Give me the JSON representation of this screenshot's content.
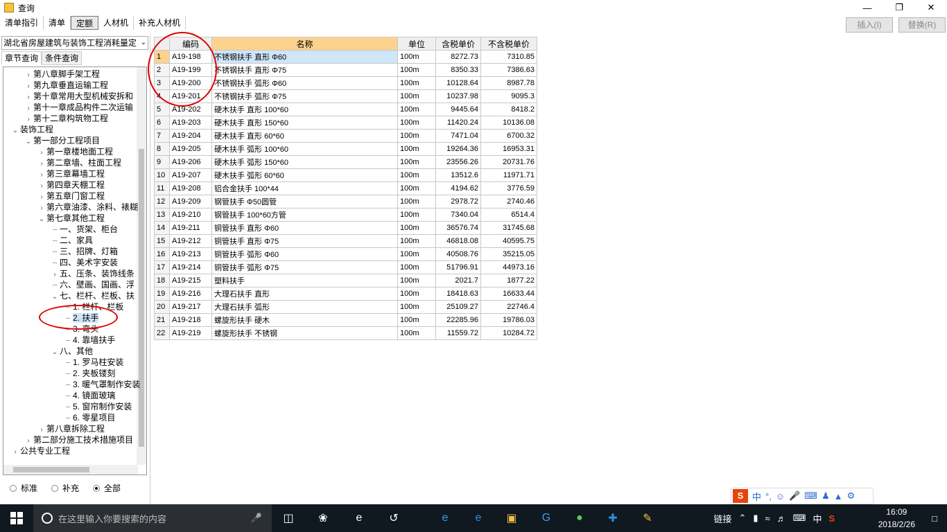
{
  "window": {
    "title": "查询"
  },
  "tabs": [
    "清单指引",
    "清单",
    "定额",
    "人材机",
    "补充人材机"
  ],
  "buttons": {
    "insert": "插入(I)",
    "replace": "替换(R)"
  },
  "left": {
    "quota_select": "湖北省房屋建筑与装饰工程消耗量定",
    "subtabs": [
      "章节查询",
      "条件查询"
    ],
    "tree": [
      {
        "label": "第八章脚手架工程",
        "icon": "chevron-right"
      },
      {
        "label": "第九章垂直运输工程",
        "icon": "chevron-right"
      },
      {
        "label": "第十章常用大型机械安拆和",
        "icon": "chevron-right"
      },
      {
        "label": "第十一章成品构件二次运输",
        "icon": "chevron-right"
      },
      {
        "label": "第十二章构筑物工程",
        "icon": "chevron-right"
      },
      {
        "label": "装饰工程",
        "icon": "chevron-down"
      },
      {
        "label": "第一部分工程项目",
        "icon": "chevron-down"
      },
      {
        "label": "第一章楼地面工程",
        "icon": "chevron-right"
      },
      {
        "label": "第二章墙、柱面工程",
        "icon": "chevron-right"
      },
      {
        "label": "第三章幕墙工程",
        "icon": "chevron-right"
      },
      {
        "label": "第四章天棚工程",
        "icon": "chevron-right"
      },
      {
        "label": "第五章门窗工程",
        "icon": "chevron-right"
      },
      {
        "label": "第六章油漆、涂料、裱糊",
        "icon": "chevron-right"
      },
      {
        "label": "第七章其他工程",
        "icon": "chevron-down"
      },
      {
        "label": "一、货架、柜台",
        "icon": ""
      },
      {
        "label": "二、家具",
        "icon": ""
      },
      {
        "label": "三、招牌、灯箱",
        "icon": ""
      },
      {
        "label": "四、美术字安装",
        "icon": ""
      },
      {
        "label": "五、压条、装饰线条",
        "icon": "chevron-right"
      },
      {
        "label": "六、壁画、国画、浮",
        "icon": ""
      },
      {
        "label": "七、栏杆、栏板、扶",
        "icon": "chevron-down"
      },
      {
        "label": "1. 栏杆、栏板",
        "icon": ""
      },
      {
        "label": "2. 扶手",
        "icon": ""
      },
      {
        "label": "3. 弯头",
        "icon": ""
      },
      {
        "label": "4. 靠墙扶手",
        "icon": ""
      },
      {
        "label": "八、其他",
        "icon": "chevron-down"
      },
      {
        "label": "1. 罗马柱安装",
        "icon": ""
      },
      {
        "label": "2. 夹板镂刻",
        "icon": ""
      },
      {
        "label": "3. 暖气罩制作安装",
        "icon": ""
      },
      {
        "label": "4. 镜面玻璃",
        "icon": ""
      },
      {
        "label": "5. 窗帘制作安装",
        "icon": ""
      },
      {
        "label": "6. 零星项目",
        "icon": ""
      },
      {
        "label": "第八章拆除工程",
        "icon": "chevron-right"
      },
      {
        "label": "第二部分施工技术措施项目",
        "icon": "chevron-right"
      },
      {
        "label": "公共专业工程",
        "icon": "chevron-right"
      }
    ],
    "radios": [
      "标准",
      "补充",
      "全部"
    ],
    "radio_selected": "全部"
  },
  "table": {
    "headers": [
      "编码",
      "名称",
      "单位",
      "含税单价",
      "不含税单价"
    ],
    "rows": [
      [
        "1",
        "A19-198",
        "不锈钢扶手 直形 Φ60",
        "100m",
        "8272.73",
        "7310.85"
      ],
      [
        "2",
        "A19-199",
        "不锈钢扶手 直形 Φ75",
        "100m",
        "8350.33",
        "7386.63"
      ],
      [
        "3",
        "A19-200",
        "不锈钢扶手 弧形 Φ60",
        "100m",
        "10128.64",
        "8987.78"
      ],
      [
        "4",
        "A19-201",
        "不锈钢扶手 弧形 Φ75",
        "100m",
        "10237.98",
        "9095.3"
      ],
      [
        "5",
        "A19-202",
        "硬木扶手 直形 100*60",
        "100m",
        "9445.64",
        "8418.2"
      ],
      [
        "6",
        "A19-203",
        "硬木扶手 直形 150*60",
        "100m",
        "11420.24",
        "10136.08"
      ],
      [
        "7",
        "A19-204",
        "硬木扶手 直形 60*60",
        "100m",
        "7471.04",
        "6700.32"
      ],
      [
        "8",
        "A19-205",
        "硬木扶手 弧形 100*60",
        "100m",
        "19264.36",
        "16953.31"
      ],
      [
        "9",
        "A19-206",
        "硬木扶手 弧形 150*60",
        "100m",
        "23556.26",
        "20731.76"
      ],
      [
        "10",
        "A19-207",
        "硬木扶手 弧形 60*60",
        "100m",
        "13512.6",
        "11971.71"
      ],
      [
        "11",
        "A19-208",
        "铝合金扶手 100*44",
        "100m",
        "4194.62",
        "3776.59"
      ],
      [
        "12",
        "A19-209",
        "钢管扶手 Φ50圆管",
        "100m",
        "2978.72",
        "2740.46"
      ],
      [
        "13",
        "A19-210",
        "钢管扶手 100*60方管",
        "100m",
        "7340.04",
        "6514.4"
      ],
      [
        "14",
        "A19-211",
        "铜管扶手 直形 Φ60",
        "100m",
        "36576.74",
        "31745.68"
      ],
      [
        "15",
        "A19-212",
        "铜管扶手 直形 Φ75",
        "100m",
        "46818.08",
        "40595.75"
      ],
      [
        "16",
        "A19-213",
        "铜管扶手 弧形 Φ60",
        "100m",
        "40508.76",
        "35215.05"
      ],
      [
        "17",
        "A19-214",
        "铜管扶手 弧形 Φ75",
        "100m",
        "51796.91",
        "44973.16"
      ],
      [
        "18",
        "A19-215",
        "塑料扶手",
        "100m",
        "2021.7",
        "1877.22"
      ],
      [
        "19",
        "A19-216",
        "大理石扶手 直形",
        "100m",
        "18418.63",
        "16633.44"
      ],
      [
        "20",
        "A19-217",
        "大理石扶手 弧形",
        "100m",
        "25109.27",
        "22746.4"
      ],
      [
        "21",
        "A19-218",
        "螺旋形扶手 硬木",
        "100m",
        "22285.96",
        "19786.03"
      ],
      [
        "22",
        "A19-219",
        "螺旋形扶手 不锈钢",
        "100m",
        "11559.72",
        "10284.72"
      ]
    ]
  },
  "ime": {
    "lang": "中"
  },
  "taskbar": {
    "search_placeholder": "在这里输入你要搜索的内容",
    "links_label": "链接",
    "ime_label": "中",
    "time": "16:09",
    "date": "2018/2/26"
  },
  "colors": {
    "selected_header": "#fcd28e",
    "selected_cell": "#cfe5f8",
    "annotation": "#e00000"
  }
}
